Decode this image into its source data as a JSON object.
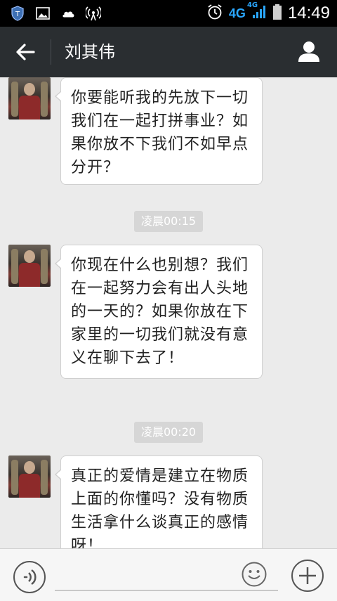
{
  "status_bar": {
    "network": "4G",
    "network_small": "4G",
    "time": "14:49",
    "icons": [
      "shield-icon",
      "image-icon",
      "cloud-icon",
      "hotspot-icon",
      "alarm-icon",
      "signal-icon",
      "battery-icon"
    ]
  },
  "header": {
    "title": "刘其伟",
    "back_icon": "back-arrow-icon",
    "profile_icon": "person-icon"
  },
  "messages": [
    {
      "type": "received",
      "text": "你要能听我的先放下一切我们在一起打拼事业？如果你放不下我们不如早点分开？"
    },
    {
      "type": "timestamp",
      "text": "凌晨00:15"
    },
    {
      "type": "received",
      "text": "你现在什么也别想？我们在一起努力会有出人头地的一天的？如果你放在下家里的一切我们就没有意义在聊下去了！"
    },
    {
      "type": "timestamp",
      "text": "凌晨00:20"
    },
    {
      "type": "received",
      "text": "真正的爱情是建立在物质上面的你懂吗？没有物质生活拿什么谈真正的感情呀！"
    }
  ],
  "input_bar": {
    "voice_icon": "voice-icon",
    "emoji_icon": "emoji-icon",
    "plus_icon": "plus-icon",
    "value": ""
  },
  "colors": {
    "header_bg": "#2a2e31",
    "chat_bg": "#ebebeb",
    "status_bg": "#000000",
    "network_blue": "#2aa7ff"
  }
}
